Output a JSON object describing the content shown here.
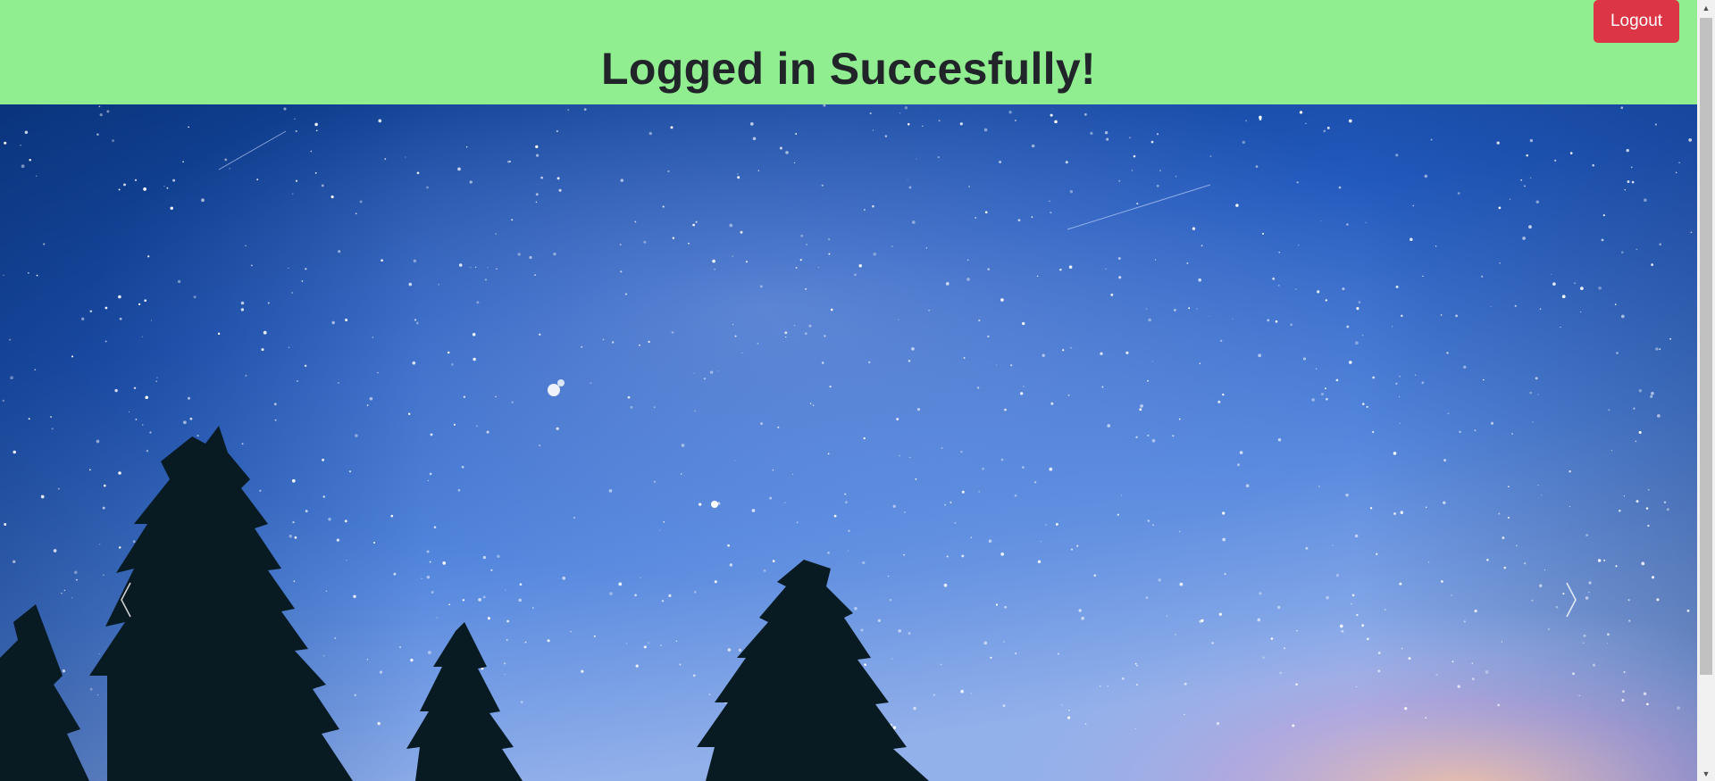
{
  "header": {
    "title": "Logged in Succesfully!",
    "background_color": "#90ee90"
  },
  "logout_button": {
    "label": "Logout",
    "color": "#dc3545"
  },
  "carousel": {
    "image_icon": "starry-night-sky-with-pine-trees",
    "prev_icon": "chevron-left-icon",
    "next_icon": "chevron-right-icon"
  },
  "scrollbar": {
    "up_icon": "triangle-up-icon",
    "down_icon": "triangle-down-icon"
  }
}
